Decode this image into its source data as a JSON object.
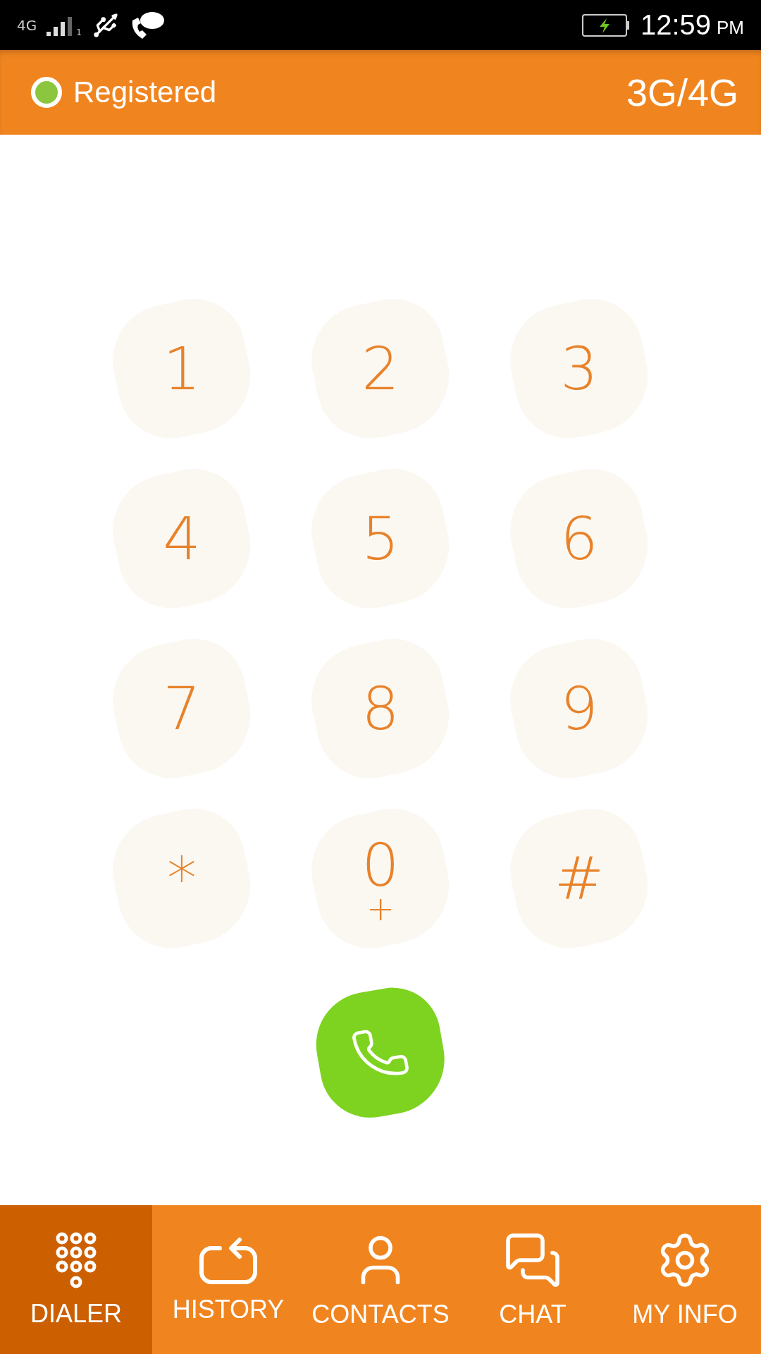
{
  "status_bar": {
    "network": "4G",
    "sim": "1",
    "time": "12:59",
    "ampm": "PM"
  },
  "header": {
    "status": "Registered",
    "registered": true,
    "connection": "3G/4G"
  },
  "keypad": [
    {
      "digit": "1"
    },
    {
      "digit": "2"
    },
    {
      "digit": "3"
    },
    {
      "digit": "4"
    },
    {
      "digit": "5"
    },
    {
      "digit": "6"
    },
    {
      "digit": "7"
    },
    {
      "digit": "8"
    },
    {
      "digit": "9"
    },
    {
      "digit": "*"
    },
    {
      "digit": "0",
      "sub": "+"
    },
    {
      "digit": "#"
    }
  ],
  "tabs": [
    {
      "label": "DIALER",
      "selected": true
    },
    {
      "label": "HISTORY",
      "selected": false
    },
    {
      "label": "CONTACTS",
      "selected": false
    },
    {
      "label": "CHAT",
      "selected": false
    },
    {
      "label": "MY INFO",
      "selected": false
    }
  ]
}
